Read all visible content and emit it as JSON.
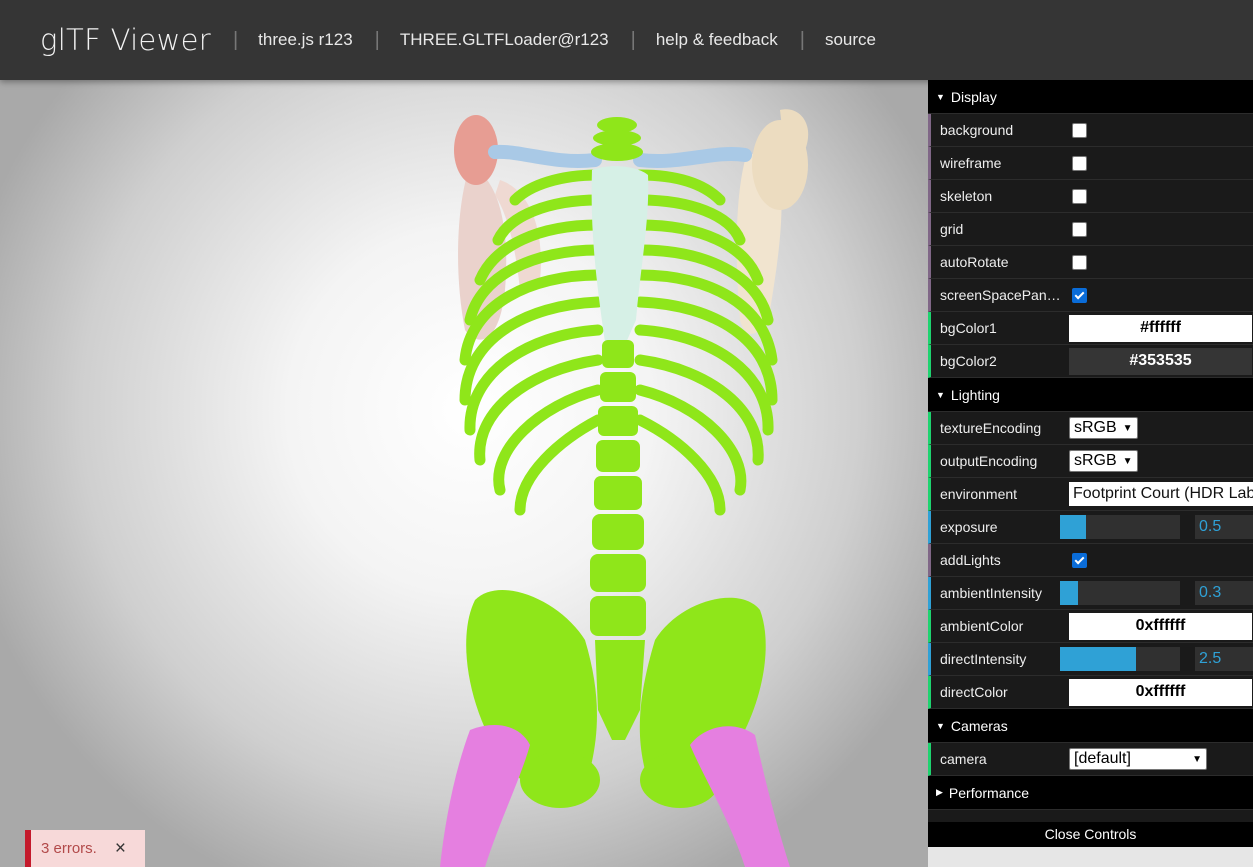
{
  "header": {
    "title": "glTF Viewer",
    "links": [
      "three.js r123",
      "THREE.GLTFLoader@r123",
      "help & feedback",
      "source"
    ]
  },
  "display": {
    "title": "Display",
    "background": {
      "label": "background",
      "checked": false
    },
    "wireframe": {
      "label": "wireframe",
      "checked": false
    },
    "skeleton": {
      "label": "skeleton",
      "checked": false
    },
    "grid": {
      "label": "grid",
      "checked": false
    },
    "autoRotate": {
      "label": "autoRotate",
      "checked": false
    },
    "screenSpacePanning": {
      "label": "screenSpacePanning",
      "checked": true
    },
    "bgColor1": {
      "label": "bgColor1",
      "value": "#ffffff"
    },
    "bgColor2": {
      "label": "bgColor2",
      "value": "#353535"
    }
  },
  "lighting": {
    "title": "Lighting",
    "textureEncoding": {
      "label": "textureEncoding",
      "value": "sRGB"
    },
    "outputEncoding": {
      "label": "outputEncoding",
      "value": "sRGB"
    },
    "environment": {
      "label": "environment",
      "value": "Footprint Court (HDR Labs)"
    },
    "exposure": {
      "label": "exposure",
      "value": "0.5",
      "fraction": 0.22
    },
    "addLights": {
      "label": "addLights",
      "checked": true
    },
    "ambientIntensity": {
      "label": "ambientIntensity",
      "value": "0.3",
      "fraction": 0.15
    },
    "ambientColor": {
      "label": "ambientColor",
      "value": "0xffffff"
    },
    "directIntensity": {
      "label": "directIntensity",
      "value": "2.5",
      "fraction": 0.63
    },
    "directColor": {
      "label": "directColor",
      "value": "0xffffff"
    }
  },
  "cameras": {
    "title": "Cameras",
    "camera": {
      "label": "camera",
      "value": "[default]"
    }
  },
  "performance": {
    "title": "Performance"
  },
  "close_controls": "Close Controls",
  "error_toast": {
    "message": "3 errors.",
    "close": "×"
  },
  "colors": {
    "bone_green": "#8fe61a",
    "pelvis_pink": "#e57fe0",
    "scapula_left": "#e79d93",
    "scapula_right": "#ecdcc0",
    "clavicle": "#a9c9e6",
    "sternum": "#d6f0e6",
    "slider_blue": "#2fa1d6"
  }
}
